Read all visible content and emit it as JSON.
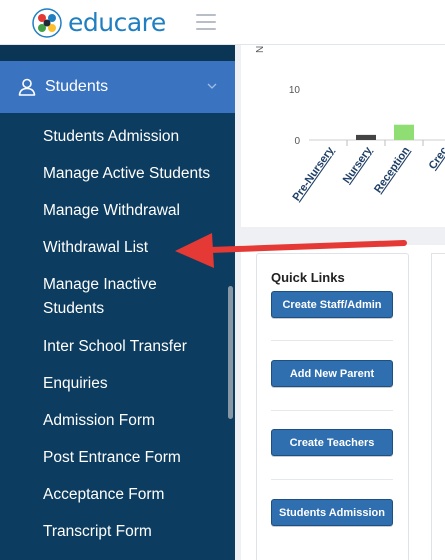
{
  "brand": {
    "name": "educare",
    "color": "#1f7fc1"
  },
  "topbar": {
    "menu_icon": "hamburger-icon"
  },
  "sidebar": {
    "section": {
      "label": "Students",
      "icon": "user-icon",
      "expand_icon": "chevron-down-icon"
    },
    "items": [
      {
        "label": "Students Admission"
      },
      {
        "label": "Manage Active Students"
      },
      {
        "label": "Manage Withdrawal"
      },
      {
        "label": "Withdrawal List"
      },
      {
        "label": "Manage Inactive Students"
      },
      {
        "label": "Inter School Transfer"
      },
      {
        "label": "Enquiries"
      },
      {
        "label": "Admission Form"
      },
      {
        "label": "Post Entrance Form"
      },
      {
        "label": "Acceptance Form"
      },
      {
        "label": "Transcript Form"
      }
    ]
  },
  "chart_data": {
    "type": "bar",
    "categories": [
      "Pre-Nursery",
      "Nursery",
      "Reception",
      "Crec"
    ],
    "values": [
      0,
      1,
      3,
      0
    ],
    "colors": [
      "#555555",
      "#444444",
      "#8fde73",
      "#777777"
    ],
    "ytick_labels": [
      "10",
      "0"
    ],
    "ylabel": "N",
    "ylim": [
      0,
      10
    ]
  },
  "quick_links": {
    "title": "Quick Links",
    "buttons": [
      {
        "label": "Create Staff/Admin"
      },
      {
        "label": "Add New Parent"
      },
      {
        "label": "Create Teachers"
      },
      {
        "label": "Students Admission"
      }
    ]
  },
  "annotation": {
    "color": "#e53935",
    "target": "Withdrawal List"
  }
}
